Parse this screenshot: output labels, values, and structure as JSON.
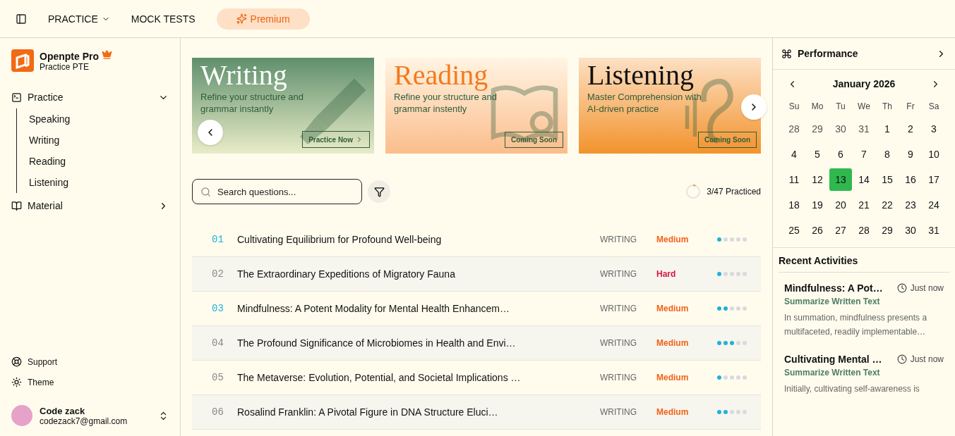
{
  "topbar": {
    "nav": [
      {
        "label": "PRACTICE",
        "kind": "dropdown"
      },
      {
        "label": "MOCK TESTS",
        "kind": "link"
      },
      {
        "label": "Premium",
        "kind": "premium"
      }
    ]
  },
  "sidebar": {
    "brand": {
      "name": "Openpte Pro",
      "subtitle": "Practice PTE"
    },
    "groups": [
      {
        "label": "Practice",
        "kind": "practice",
        "expanded": true,
        "children": [
          {
            "label": "Speaking"
          },
          {
            "label": "Writing"
          },
          {
            "label": "Reading"
          },
          {
            "label": "Listening"
          }
        ]
      },
      {
        "label": "Material",
        "kind": "material",
        "expanded": false
      }
    ],
    "footer_links": [
      {
        "label": "Support",
        "kind": "support"
      },
      {
        "label": "Theme",
        "kind": "theme"
      }
    ],
    "user": {
      "name": "Code zack",
      "email": "codezack7@gmail.com"
    }
  },
  "banners": [
    {
      "kind": "writing",
      "title": "Writing",
      "subtitle": "Refine your structure and grammar instantly",
      "button": "Practice Now"
    },
    {
      "kind": "reading",
      "title": "Reading",
      "subtitle": "Refine your structure and grammar instently",
      "button": "Coming Soon"
    },
    {
      "kind": "listening",
      "title": "Listening",
      "subtitle": "Master Comprehension with AI-driven practice",
      "button": "Coming Soon"
    }
  ],
  "search": {
    "placeholder": "Search questions..."
  },
  "progress": {
    "text": "3/47 Practiced",
    "level": 0.06
  },
  "questions": [
    {
      "number": "01",
      "attempted": true,
      "title": "Cultivating Equilibrium for Profound Well-being",
      "category": "WRITING",
      "difficulty": "Medium",
      "color": "#f2621a",
      "stars": 1
    },
    {
      "number": "02",
      "attempted": false,
      "title": "The Extraordinary Expeditions of Migratory Fauna",
      "category": "WRITING",
      "difficulty": "Hard",
      "color": "#d6143f",
      "stars": 1
    },
    {
      "number": "03",
      "attempted": true,
      "title": "Mindfulness: A Potent Modality for Mental Health Enhancem…",
      "category": "WRITING",
      "difficulty": "Medium",
      "color": "#f2621a",
      "stars": 2
    },
    {
      "number": "04",
      "attempted": false,
      "title": "The Profound Significance of Microbiomes in Health and Envi…",
      "category": "WRITING",
      "difficulty": "Medium",
      "color": "#f2621a",
      "stars": 3
    },
    {
      "number": "05",
      "attempted": false,
      "title": "The Metaverse: Evolution, Potential, and Societal Implications …",
      "category": "WRITING",
      "difficulty": "Medium",
      "color": "#f2621a",
      "stars": 1
    },
    {
      "number": "06",
      "attempted": false,
      "title": "Rosalind Franklin: A Pivotal Figure in DNA Structure Eluci…",
      "category": "WRITING",
      "difficulty": "Medium",
      "color": "#f2621a",
      "stars": 2
    }
  ],
  "performance": {
    "title": "Performance"
  },
  "calendar": {
    "month": "January 2026",
    "weekdays": [
      "Su",
      "Mo",
      "Tu",
      "We",
      "Th",
      "Fr",
      "Sa"
    ],
    "days": [
      {
        "label": "28",
        "outside": true,
        "selected": false
      },
      {
        "label": "29",
        "outside": true,
        "selected": false
      },
      {
        "label": "30",
        "outside": true,
        "selected": false
      },
      {
        "label": "31",
        "outside": true,
        "selected": false
      },
      {
        "label": "1",
        "outside": false,
        "selected": false
      },
      {
        "label": "2",
        "outside": false,
        "selected": false
      },
      {
        "label": "3",
        "outside": false,
        "selected": false
      },
      {
        "label": "4",
        "outside": false,
        "selected": false
      },
      {
        "label": "5",
        "outside": false,
        "selected": false
      },
      {
        "label": "6",
        "outside": false,
        "selected": false
      },
      {
        "label": "7",
        "outside": false,
        "selected": false
      },
      {
        "label": "8",
        "outside": false,
        "selected": false
      },
      {
        "label": "9",
        "outside": false,
        "selected": false
      },
      {
        "label": "10",
        "outside": false,
        "selected": false
      },
      {
        "label": "11",
        "outside": false,
        "selected": false
      },
      {
        "label": "12",
        "outside": false,
        "selected": false
      },
      {
        "label": "13",
        "outside": false,
        "selected": true
      },
      {
        "label": "14",
        "outside": false,
        "selected": false
      },
      {
        "label": "15",
        "outside": false,
        "selected": false
      },
      {
        "label": "16",
        "outside": false,
        "selected": false
      },
      {
        "label": "17",
        "outside": false,
        "selected": false
      },
      {
        "label": "18",
        "outside": false,
        "selected": false
      },
      {
        "label": "19",
        "outside": false,
        "selected": false
      },
      {
        "label": "20",
        "outside": false,
        "selected": false
      },
      {
        "label": "21",
        "outside": false,
        "selected": false
      },
      {
        "label": "22",
        "outside": false,
        "selected": false
      },
      {
        "label": "23",
        "outside": false,
        "selected": false
      },
      {
        "label": "24",
        "outside": false,
        "selected": false
      },
      {
        "label": "25",
        "outside": false,
        "selected": false
      },
      {
        "label": "26",
        "outside": false,
        "selected": false
      },
      {
        "label": "27",
        "outside": false,
        "selected": false
      },
      {
        "label": "28",
        "outside": false,
        "selected": false
      },
      {
        "label": "29",
        "outside": false,
        "selected": false
      },
      {
        "label": "30",
        "outside": false,
        "selected": false
      },
      {
        "label": "31",
        "outside": false,
        "selected": false
      }
    ]
  },
  "recent": {
    "title": "Recent Activities",
    "items": [
      {
        "title": "Mindfulness: A Pot…",
        "time": "Just now",
        "type": "Summarize Written Text",
        "excerpt": "In summation, mindfulness presents a multifaceted, readily implementable…"
      },
      {
        "title": "Cultivating Mental …",
        "time": "Just now",
        "type": "Summarize Written Text",
        "excerpt": "Initially, cultivating self-awareness is"
      }
    ]
  }
}
